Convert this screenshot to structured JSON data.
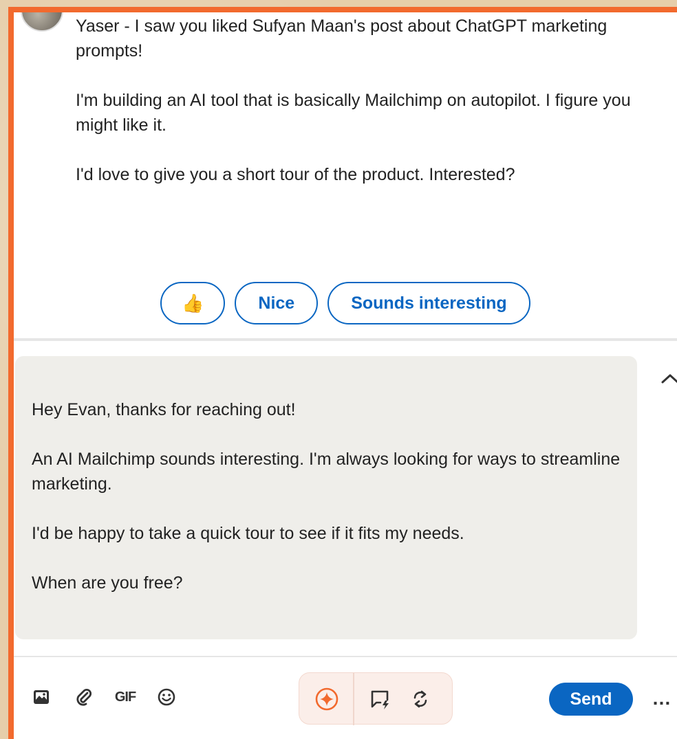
{
  "conversation": {
    "incoming_message": {
      "paragraphs": [
        "Yaser - I saw you liked Sufyan Maan's post about ChatGPT marketing prompts!",
        "I'm building an AI tool that is basically Mailchimp on autopilot. I figure you might like it.",
        "I'd love to give you a short tour of the product. Interested?"
      ]
    },
    "quick_replies": [
      {
        "label": "👍"
      },
      {
        "label": "Nice"
      },
      {
        "label": "Sounds interesting"
      }
    ]
  },
  "composer": {
    "paragraphs": [
      "Hey Evan, thanks for reaching out!",
      "An AI Mailchimp sounds interesting. I'm always looking for ways to streamline marketing.",
      "I'd be happy to take a quick tour to see if it fits my needs.",
      "When are you free?"
    ]
  },
  "toolbar": {
    "gif_label": "GIF",
    "send_label": "Send",
    "more_label": "…",
    "icons": [
      "image-icon",
      "attachment-icon",
      "gif-icon",
      "emoji-icon",
      "ai-sparkle-icon",
      "message-ai-icon",
      "rewrite-icon",
      "more-icon"
    ]
  },
  "colors": {
    "accent": "#0a66c2",
    "frame_border": "#f26a2e",
    "ai_orange": "#f26a2e"
  }
}
